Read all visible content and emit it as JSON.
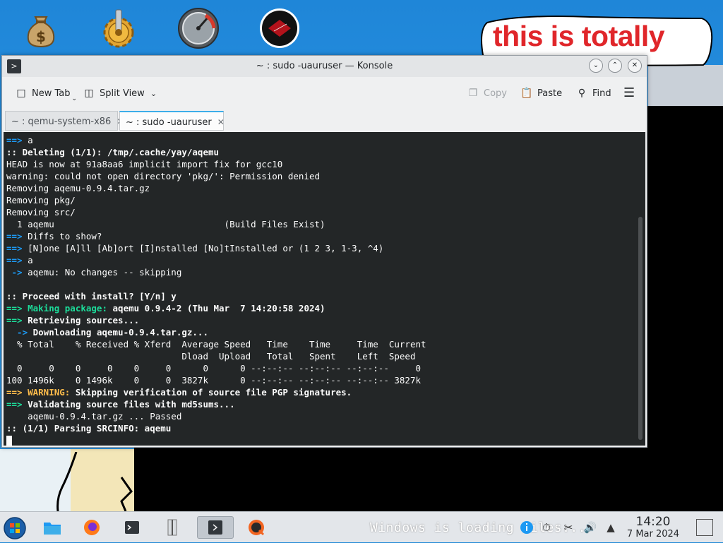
{
  "desktop": {
    "icons": [
      "money-bag-icon",
      "gear-icon",
      "speedometer-icon",
      "red-disc-icon"
    ],
    "annotation_text": "this is totally",
    "overlay_text": "Windows is loading files..."
  },
  "window": {
    "title": "~ : sudo -uauruser — Konsole",
    "buttons": [
      "minimize-icon",
      "maximize-icon",
      "close-icon"
    ]
  },
  "toolbar": {
    "new_tab": "New Tab",
    "split_view": "Split View",
    "copy": "Copy",
    "paste": "Paste",
    "find": "Find"
  },
  "tabs": [
    {
      "label": "~ : qemu-system-x86",
      "active": false
    },
    {
      "label": "~ : sudo -uauruser",
      "active": true
    }
  ],
  "terminal": {
    "lines": [
      "==> a",
      ":: Deleting (1/1): /tmp/.cache/yay/aqemu",
      "HEAD is now at 91a8aa6 implicit import fix for gcc10",
      "warning: could not open directory 'pkg/': Permission denied",
      "Removing aqemu-0.9.4.tar.gz",
      "Removing pkg/",
      "Removing src/",
      "  1 aqemu                                (Build Files Exist)",
      "==> Diffs to show?",
      "==> [N]one [A]ll [Ab]ort [I]nstalled [No]tInstalled or (1 2 3, 1-3, ^4)",
      "==> a",
      " -> aqemu: No changes -- skipping",
      "",
      ":: Proceed with install? [Y/n] y",
      "==> Making package: aqemu 0.9.4-2 (Thu Mar  7 14:20:58 2024)",
      "==> Retrieving sources...",
      "  -> Downloading aqemu-0.9.4.tar.gz...",
      "  % Total    % Received % Xferd  Average Speed   Time    Time     Time  Current",
      "                                 Dload  Upload   Total   Spent    Left  Speed",
      "  0     0    0     0    0     0      0      0 --:--:-- --:--:-- --:--:--     0",
      "100 1496k    0 1496k    0     0  3827k      0 --:--:-- --:--:-- --:--:-- 3827k",
      "==> WARNING: Skipping verification of source file PGP signatures.",
      "==> Validating source files with md5sums...",
      "    aqemu-0.9.4.tar.gz ... Passed",
      ":: (1/1) Parsing SRCINFO: aqemu"
    ]
  },
  "taskbar": {
    "start": "start-orb-icon",
    "apps": [
      "file-manager-icon",
      "firefox-icon",
      "terminal-task-icon",
      "archive-icon",
      "konsole-task-icon",
      "qemu-icon"
    ],
    "clock_time": "14:20",
    "clock_date": "7 Mar 2024"
  }
}
